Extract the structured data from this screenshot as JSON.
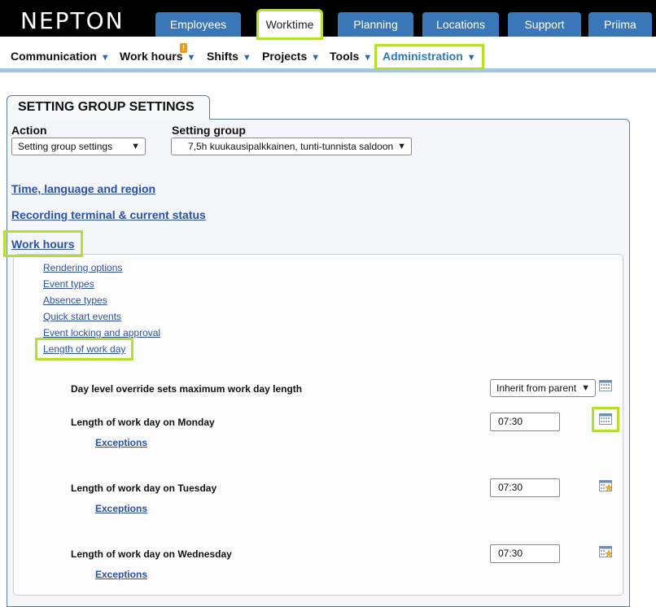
{
  "brand": "NEPTON",
  "top_tabs": [
    "Employees",
    "Worktime",
    "Planning",
    "Locations",
    "Support",
    "Priima"
  ],
  "sub_nav": [
    "Communication",
    "Work hours",
    "Shifts",
    "Projects",
    "Tools",
    "Administration"
  ],
  "work_hours_badge": "!",
  "panel_title": "SETTING GROUP SETTINGS",
  "action": {
    "label": "Action",
    "value": "Setting group settings"
  },
  "setting_group": {
    "label": "Setting group",
    "value": "7,5h kuukausipalkkainen, tunti-tunnista saldoon"
  },
  "sections": [
    "Time, language and region",
    "Recording terminal & current status",
    "Work hours"
  ],
  "work_hours_links": [
    "Rendering options",
    "Event types",
    "Absence types",
    "Quick start events",
    "Event locking and approval",
    "Length of work day"
  ],
  "override": {
    "label": "Day level override sets maximum work day length",
    "value": "Inherit from parent"
  },
  "days": [
    {
      "label": "Length of work day on Monday",
      "value": "07:30",
      "exceptions": "Exceptions"
    },
    {
      "label": "Length of work day on Tuesday",
      "value": "07:30",
      "exceptions": "Exceptions"
    },
    {
      "label": "Length of work day on Wednesday",
      "value": "07:30",
      "exceptions": "Exceptions"
    }
  ],
  "colors": {
    "accent_blue": "#3a77b9",
    "highlight": "#b4e02a",
    "link": "#2a4faf"
  }
}
